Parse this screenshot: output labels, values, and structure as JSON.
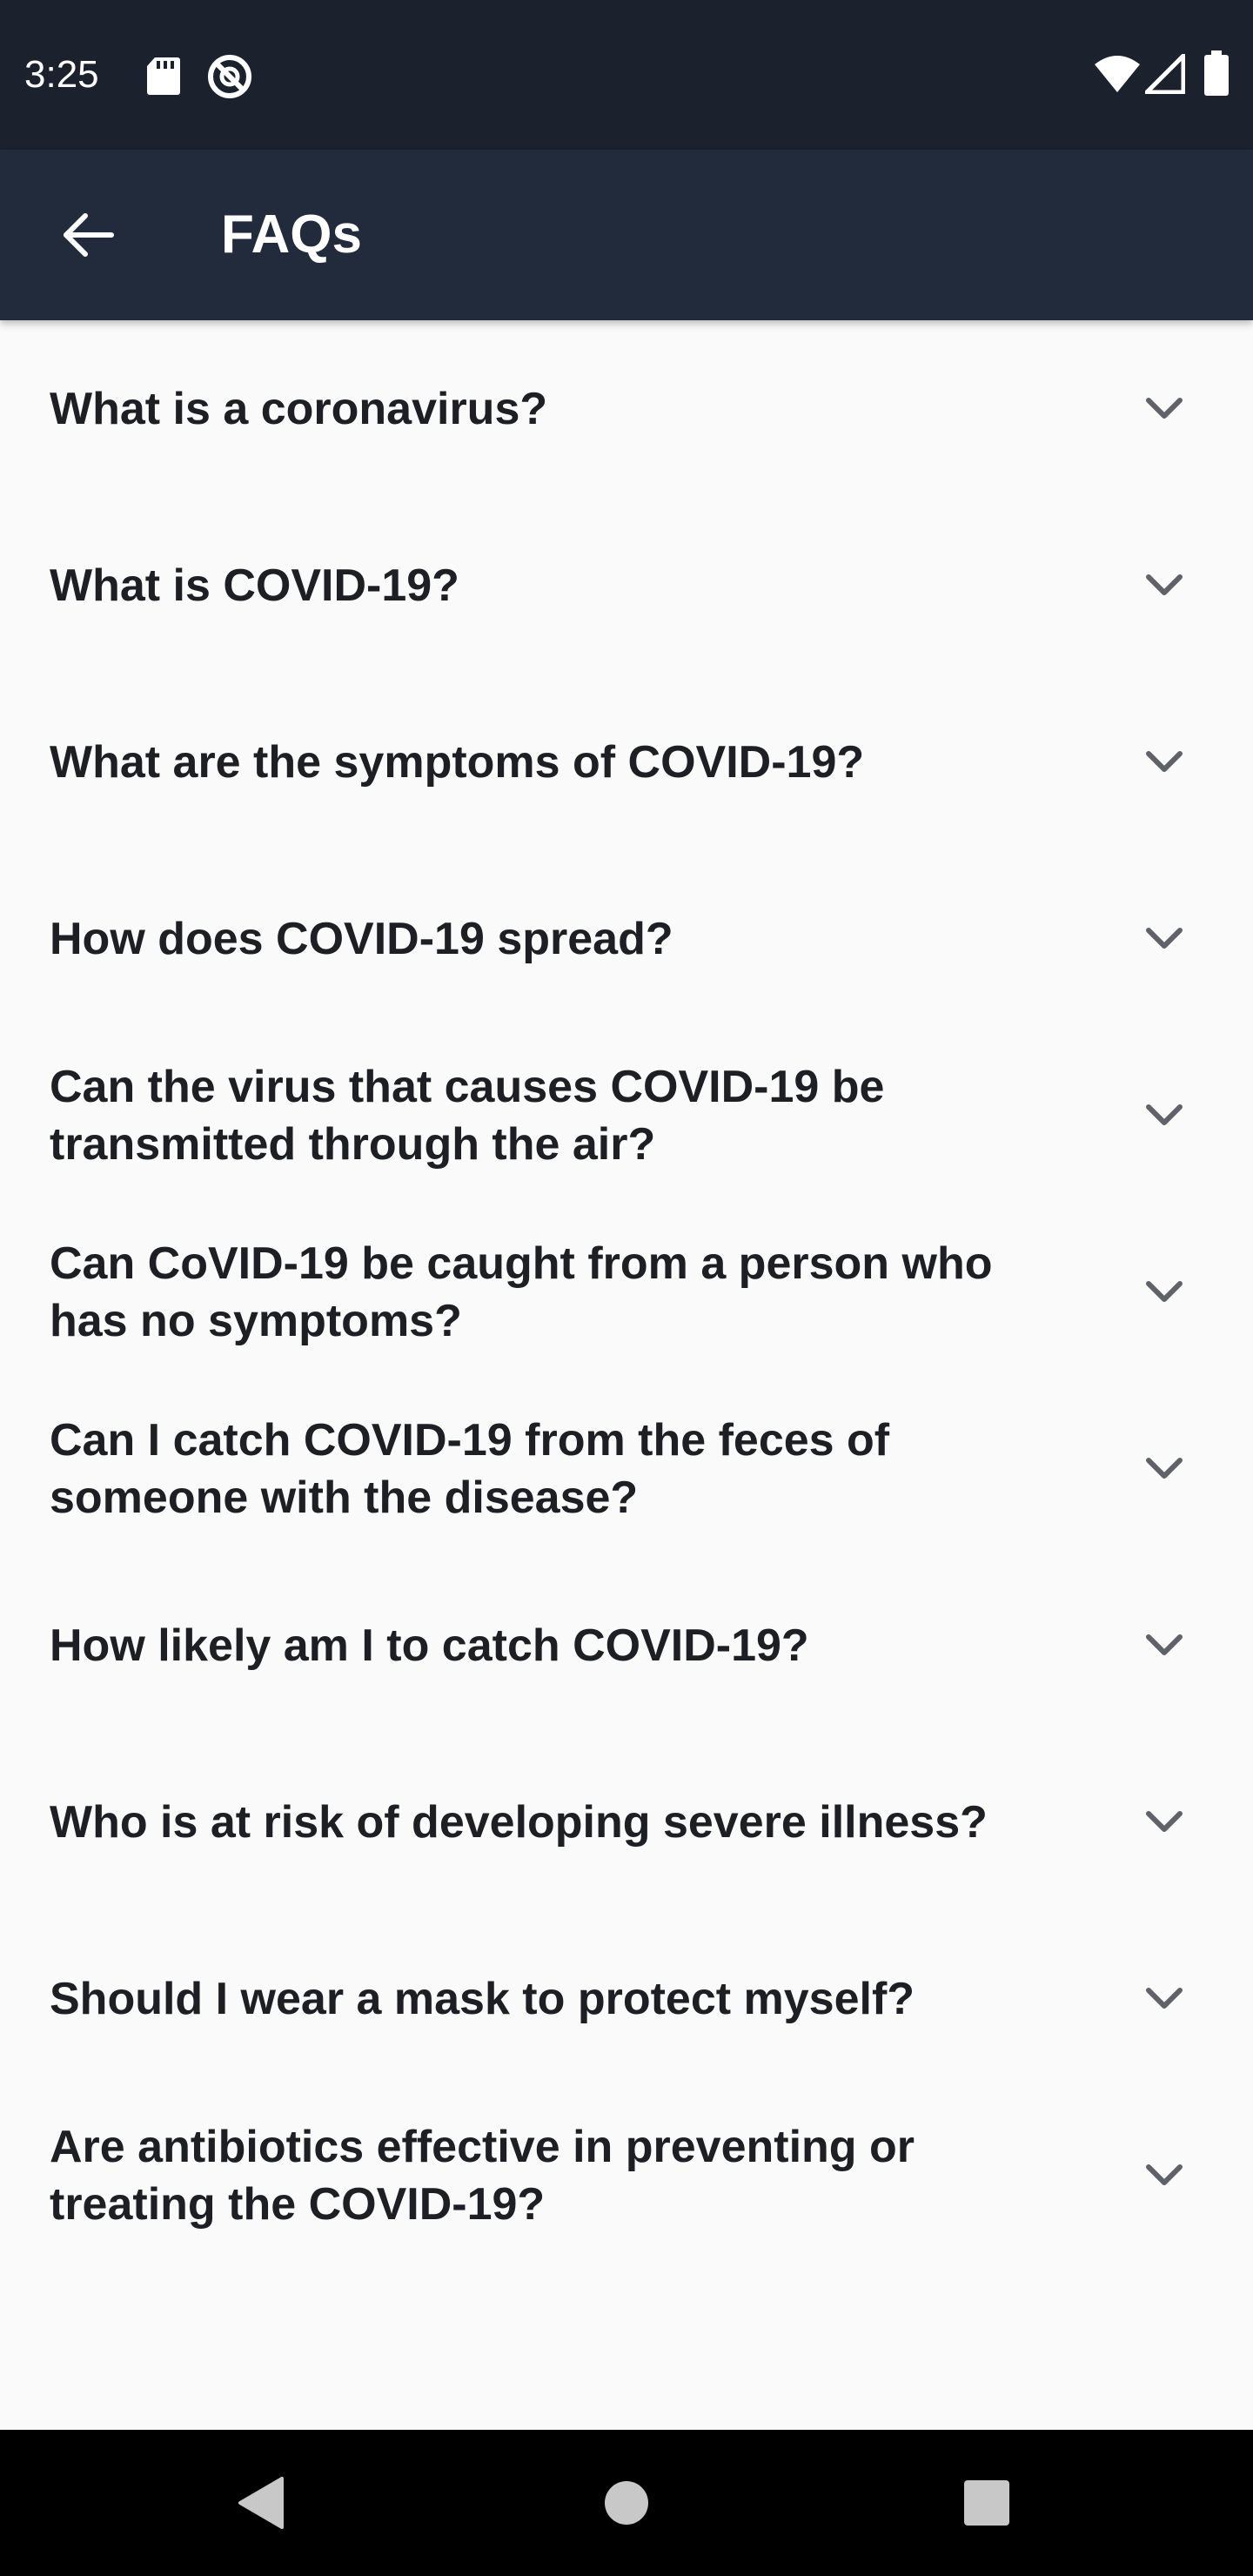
{
  "status_bar": {
    "time": "3:25",
    "left_icons": [
      "sd-card-icon",
      "no-data-saver-icon"
    ],
    "right_icons": [
      "wifi-icon",
      "cellular-signal-icon",
      "battery-icon"
    ]
  },
  "app_bar": {
    "back_icon": "arrow-left-icon",
    "title": "FAQs"
  },
  "faqs": [
    "What is a coronavirus?",
    "What is COVID-19?",
    "What are the symptoms of COVID-19?",
    "How does COVID-19 spread?",
    "Can the virus that causes COVID-19 be transmitted through the air?",
    "Can CoVID-19 be caught from a person who has no symptoms?",
    "Can I catch COVID-19 from the feces of someone with the disease?",
    "How likely am I to catch COVID-19?",
    "Who is at risk of developing severe illness?",
    "Should I wear a mask to protect myself?",
    "Are antibiotics effective in preventing or treating the COVID-19?"
  ],
  "faq_expand_icon": "chevron-down-icon",
  "nav_bar": {
    "icons": [
      "nav-back-icon",
      "nav-home-icon",
      "nav-recents-icon"
    ]
  },
  "colors": {
    "status_bar_bg": "#1c222d",
    "app_bar_bg": "#222b3c",
    "page_bg": "#fafafa",
    "question_text": "#1d1f24",
    "chevron": "#5f6268"
  }
}
